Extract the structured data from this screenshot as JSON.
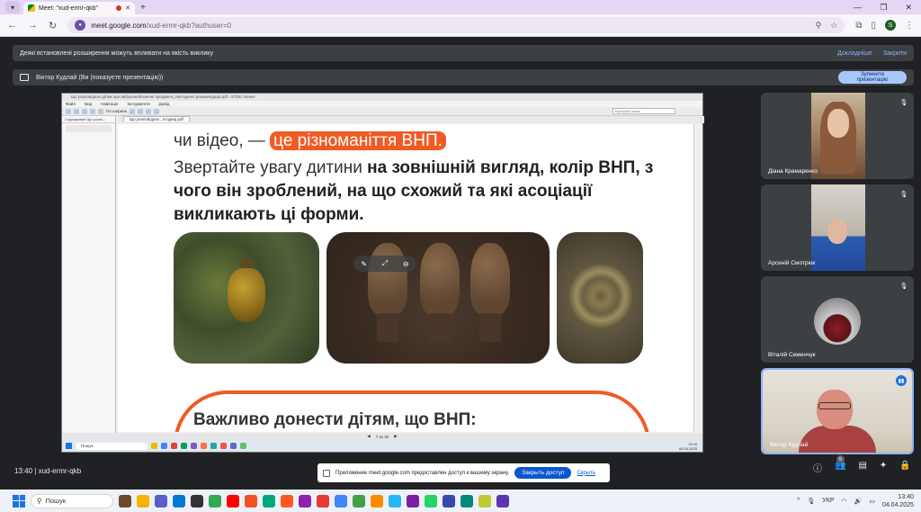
{
  "browser": {
    "tab_title": "Meet: \"xud-ermr-qkb\"",
    "url_host": "meet.google.com",
    "url_path": "/xud-ermr-qkb?authuser=0",
    "profile_initial": "S"
  },
  "infobar": {
    "message": "Деякі встановлені розширення можуть впливати на якість виклику",
    "learn_more": "Докладніше",
    "close": "Закрити"
  },
  "presenting": {
    "text": "Віктор Кудлай (Ви (показуєте презентацію))",
    "stop_button": "Зупинити презентацію"
  },
  "shared_app": {
    "window_title": "Що розповідати дітям про вибухонебезпечні предмети_Методичні рекомендації.pdf - STDU Viewer",
    "menu": [
      "Файл",
      "Вид",
      "Навігація",
      "Інструменти",
      "Довід"
    ],
    "zoom": "По ширине",
    "search_placeholder": "Быстрый поиск",
    "side_tab": "Содержание   Що розпо...",
    "doc_tab": "Що розповідати...атодиці.pdf",
    "page_indicator": "7 из 32",
    "taskbar_search": "Пошук",
    "clock_time": "13:40",
    "clock_date": "04.04.2025"
  },
  "slide": {
    "line1_prefix": "чи відео, — ",
    "line1_highlight": "це різноманіття ВНП.",
    "para_prefix": "Звертайте увагу дитини ",
    "para_bold": "на зовнішній вигляд, колір ВНП, з чого він зроблений, на що схожий та які асоціації викликають ці форми.",
    "box_title": "Важливо донести дітям, що ВНП:"
  },
  "participants": [
    {
      "name": "Діана Крамаренко",
      "muted": true
    },
    {
      "name": "Арсеній Смотрюк",
      "muted": true
    },
    {
      "name": "Віталій Семенчук",
      "muted": true
    },
    {
      "name": "Віктор Кудлай",
      "speaking": true
    }
  ],
  "meet_bottom": {
    "time": "13:40",
    "separator": "|",
    "meeting_code": "xud-ermr-qkb",
    "notification_text": "Приложение meet.google.com предоставлен доступ к вашему экрану.",
    "share_stop": "Закрыть доступ",
    "hide": "Скрыть",
    "participants_count": "5"
  },
  "taskbar": {
    "search": "Пошук",
    "lang": "УКР",
    "time": "13:40",
    "date": "04.04.2025"
  }
}
